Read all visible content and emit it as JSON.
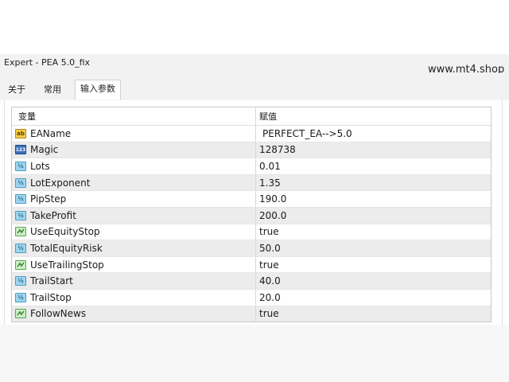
{
  "window": {
    "title": "Expert - PEA 5.0_fix"
  },
  "watermark": "www.mt4.shop",
  "tabs": [
    {
      "label": "关于"
    },
    {
      "label": "常用"
    },
    {
      "label": "输入参数"
    }
  ],
  "table": {
    "columns": {
      "variable": "变量",
      "value": "赋值"
    },
    "rows": [
      {
        "icon": "string-icon",
        "icon_text": "ab",
        "name": "EAName",
        "value": "PERFECT_EA-->5.0"
      },
      {
        "icon": "integer-icon",
        "icon_text": "123",
        "name": "Magic",
        "value": "128738"
      },
      {
        "icon": "double-icon",
        "icon_text": "½",
        "name": "Lots",
        "value": "0.01"
      },
      {
        "icon": "double-icon",
        "icon_text": "½",
        "name": "LotExponent",
        "value": "1.35"
      },
      {
        "icon": "double-icon",
        "icon_text": "½",
        "name": "PipStep",
        "value": "190.0"
      },
      {
        "icon": "double-icon",
        "icon_text": "½",
        "name": "TakeProfit",
        "value": "200.0"
      },
      {
        "icon": "bool-icon",
        "icon_text": "",
        "name": "UseEquityStop",
        "value": "true"
      },
      {
        "icon": "double-icon",
        "icon_text": "½",
        "name": "TotalEquityRisk",
        "value": "50.0"
      },
      {
        "icon": "bool-icon",
        "icon_text": "",
        "name": "UseTrailingStop",
        "value": "true"
      },
      {
        "icon": "double-icon",
        "icon_text": "½",
        "name": "TrailStart",
        "value": "40.0"
      },
      {
        "icon": "double-icon",
        "icon_text": "½",
        "name": "TrailStop",
        "value": "20.0"
      },
      {
        "icon": "bool-icon",
        "icon_text": "",
        "name": "FollowNews",
        "value": "true"
      }
    ]
  }
}
